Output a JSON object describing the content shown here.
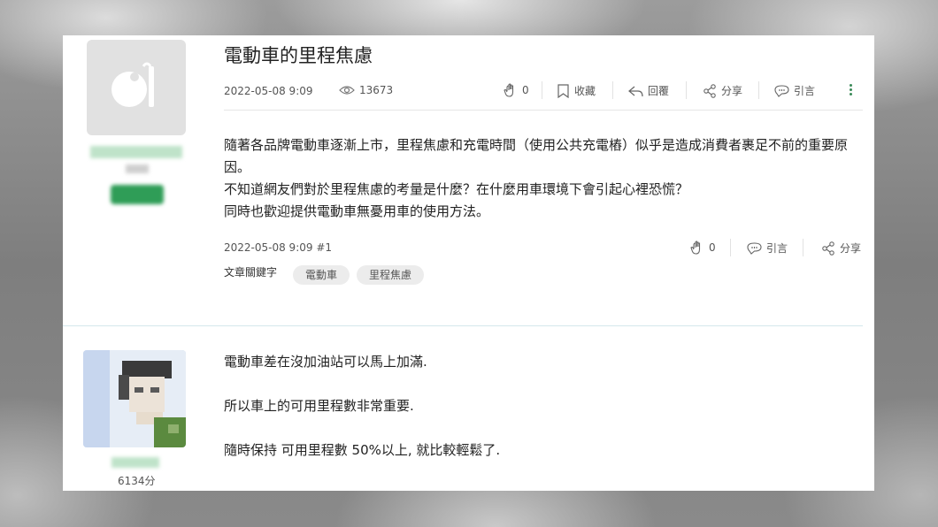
{
  "post": {
    "title": "電動車的里程焦慮",
    "date": "2022-05-08 9:09",
    "views": "13673",
    "actions": {
      "like_count": "0",
      "bookmark_label": "收藏",
      "reply_label": "回覆",
      "share_label": "分享",
      "quote_label": "引言"
    },
    "body": [
      "隨著各品牌電動車逐漸上市，里程焦慮和充電時間（使用公共充電樁）似乎是造成消費者裹足不前的重要原因。",
      "不知道網友們對於里程焦慮的考量是什麼？在什麼用車環境下會引起心裡恐慌？",
      "同時也歡迎提供電動車無憂用車的使用方法。"
    ],
    "footer": {
      "timestamp": "2022-05-08 9:09 #1",
      "like_count": "0",
      "quote_label": "引言",
      "share_label": "分享"
    },
    "keywords_label": "文章關鍵字",
    "keywords": [
      "電動車",
      "里程焦慮"
    ]
  },
  "reply": {
    "score": "6134分",
    "body": [
      "電動車差在沒加油站可以馬上加滿.",
      "所以車上的可用里程數非常重要.",
      "隨時保持 可用里程數 50%以上, 就比較輕鬆了."
    ]
  },
  "colors": {
    "accent_green": "#2f9d57",
    "divider": "#d5e7ec"
  }
}
